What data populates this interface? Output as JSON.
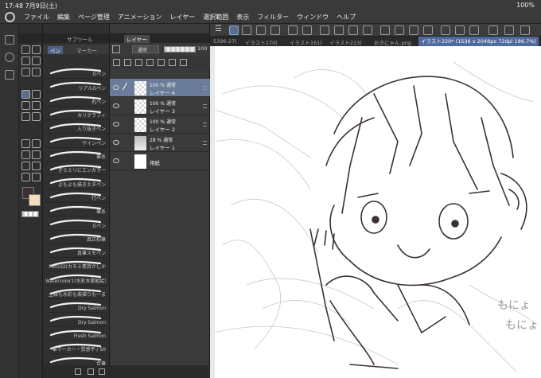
{
  "status": {
    "time_date": "17:48  7月9日(土)",
    "battery": "100%"
  },
  "menu": [
    "ファイル",
    "編集",
    "ページ管理",
    "アニメーション",
    "レイヤー",
    "選択範囲",
    "表示",
    "フィルター",
    "ウィンドウ",
    "ヘルプ"
  ],
  "subtool_panel": {
    "title": "サブツール",
    "tabs": {
      "pen": "ペン",
      "marker": "マーカー"
    },
    "brushes": [
      "Gペン",
      "リアルGペン",
      "丸ペン",
      "カリグラフィ",
      "入り抜きペン",
      "サインペン",
      "筆系",
      "ぎらミリにエンカラー",
      "よもよも描きえタペン",
      "行ペン",
      "筆系",
      "Gペン",
      "真正柏筆",
      "真筆スモペン",
      "Pencil2(カモミ素質がしか",
      "Watercolor1(水彩水歌組絵)",
      "主線も水彩も楽描りも一ま",
      "Dry Salmon",
      "Dry Salmon",
      "Fresh Salmon",
      "筆マーカー・質感平 / 50",
      "合筆",
      "我のたほんりペン"
    ],
    "selected_index": 22
  },
  "layer_panel": {
    "tab": "レイヤー",
    "blend_mode": "通常",
    "opacity": "100",
    "layers": [
      {
        "opacity": "100 %",
        "mode": "通常",
        "name": "レイヤー 4",
        "selected": true
      },
      {
        "opacity": "100 %",
        "mode": "通常",
        "name": "レイヤー 3",
        "selected": false
      },
      {
        "opacity": "100 %",
        "mode": "通常",
        "name": "レイヤー 2",
        "selected": false
      },
      {
        "opacity": "28 %",
        "mode": "通常",
        "name": "レイヤー 1",
        "selected": false
      },
      {
        "opacity": "",
        "mode": "",
        "name": "用紙",
        "selected": false
      }
    ]
  },
  "doc_tabs": [
    "5396-27(",
    "イラスト170(",
    "イラスト161(",
    "イラスト213(",
    "おきにゃん.png",
    "イラスト220* (1536 x 2048px 72dpi 186.7%)"
  ],
  "canvas_text": [
    "もにょ",
    "もにょ"
  ],
  "colors": {
    "main": "#3b3230",
    "sub": "#f6ddc0",
    "accent": "#4f6a9c"
  }
}
